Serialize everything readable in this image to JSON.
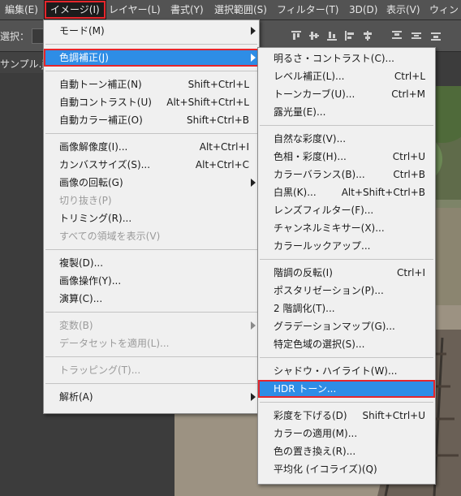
{
  "menubar": [
    {
      "label": "編集(E)",
      "active": false
    },
    {
      "label": "イメージ(I)",
      "active": true
    },
    {
      "label": "レイヤー(L)",
      "active": false
    },
    {
      "label": "書式(Y)",
      "active": false
    },
    {
      "label": "選択範囲(S)",
      "active": false
    },
    {
      "label": "フィルター(T)",
      "active": false
    },
    {
      "label": "3D(D)",
      "active": false
    },
    {
      "label": "表示(V)",
      "active": false
    },
    {
      "label": "ウィン",
      "active": false
    }
  ],
  "options_bar": {
    "label": "選択：",
    "box_text": "L"
  },
  "doc_tab": {
    "label": "サンプル.j"
  },
  "image_menu": [
    {
      "label": "モード(M)",
      "shortcut": "",
      "submenu": true,
      "disabled": false
    },
    {
      "separator": true
    },
    {
      "label": "色調補正(J)",
      "shortcut": "",
      "submenu": true,
      "disabled": false,
      "highlighted": true,
      "boxed": true
    },
    {
      "separator": true
    },
    {
      "label": "自動トーン補正(N)",
      "shortcut": "Shift+Ctrl+L",
      "disabled": false
    },
    {
      "label": "自動コントラスト(U)",
      "shortcut": "Alt+Shift+Ctrl+L",
      "disabled": false
    },
    {
      "label": "自動カラー補正(O)",
      "shortcut": "Shift+Ctrl+B",
      "disabled": false
    },
    {
      "separator": true
    },
    {
      "label": "画像解像度(I)...",
      "shortcut": "Alt+Ctrl+I",
      "disabled": false
    },
    {
      "label": "カンバスサイズ(S)...",
      "shortcut": "Alt+Ctrl+C",
      "disabled": false
    },
    {
      "label": "画像の回転(G)",
      "shortcut": "",
      "submenu": true,
      "disabled": false
    },
    {
      "label": "切り抜き(P)",
      "shortcut": "",
      "disabled": true
    },
    {
      "label": "トリミング(R)...",
      "shortcut": "",
      "disabled": false
    },
    {
      "label": "すべての領域を表示(V)",
      "shortcut": "",
      "disabled": true
    },
    {
      "separator": true
    },
    {
      "label": "複製(D)...",
      "shortcut": "",
      "disabled": false
    },
    {
      "label": "画像操作(Y)...",
      "shortcut": "",
      "disabled": false
    },
    {
      "label": "演算(C)...",
      "shortcut": "",
      "disabled": false
    },
    {
      "separator": true
    },
    {
      "label": "変数(B)",
      "shortcut": "",
      "submenu": true,
      "disabled": true
    },
    {
      "label": "データセットを適用(L)...",
      "shortcut": "",
      "disabled": true
    },
    {
      "separator": true
    },
    {
      "label": "トラッピング(T)...",
      "shortcut": "",
      "disabled": true
    },
    {
      "separator": true
    },
    {
      "label": "解析(A)",
      "shortcut": "",
      "submenu": true,
      "disabled": false
    }
  ],
  "adjust_menu": [
    {
      "label": "明るさ・コントラスト(C)...",
      "shortcut": "",
      "disabled": false
    },
    {
      "label": "レベル補正(L)...",
      "shortcut": "Ctrl+L",
      "disabled": false
    },
    {
      "label": "トーンカーブ(U)...",
      "shortcut": "Ctrl+M",
      "disabled": false
    },
    {
      "label": "露光量(E)...",
      "shortcut": "",
      "disabled": false
    },
    {
      "separator": true
    },
    {
      "label": "自然な彩度(V)...",
      "shortcut": "",
      "disabled": false
    },
    {
      "label": "色相・彩度(H)...",
      "shortcut": "Ctrl+U",
      "disabled": false
    },
    {
      "label": "カラーバランス(B)...",
      "shortcut": "Ctrl+B",
      "disabled": false
    },
    {
      "label": "白黒(K)...",
      "shortcut": "Alt+Shift+Ctrl+B",
      "disabled": false
    },
    {
      "label": "レンズフィルター(F)...",
      "shortcut": "",
      "disabled": false
    },
    {
      "label": "チャンネルミキサー(X)...",
      "shortcut": "",
      "disabled": false
    },
    {
      "label": "カラールックアップ...",
      "shortcut": "",
      "disabled": false
    },
    {
      "separator": true
    },
    {
      "label": "階調の反転(I)",
      "shortcut": "Ctrl+I",
      "disabled": false
    },
    {
      "label": "ポスタリゼーション(P)...",
      "shortcut": "",
      "disabled": false
    },
    {
      "label": "2 階調化(T)...",
      "shortcut": "",
      "disabled": false
    },
    {
      "label": "グラデーションマップ(G)...",
      "shortcut": "",
      "disabled": false
    },
    {
      "label": "特定色域の選択(S)...",
      "shortcut": "",
      "disabled": false
    },
    {
      "separator": true
    },
    {
      "label": "シャドウ・ハイライト(W)...",
      "shortcut": "",
      "disabled": false
    },
    {
      "label": "HDR トーン...",
      "shortcut": "",
      "disabled": false,
      "highlighted": true,
      "boxed": true
    },
    {
      "separator": true
    },
    {
      "label": "彩度を下げる(D)",
      "shortcut": "Shift+Ctrl+U",
      "disabled": false
    },
    {
      "label": "カラーの適用(M)...",
      "shortcut": "",
      "disabled": false
    },
    {
      "label": "色の置き換え(R)...",
      "shortcut": "",
      "disabled": false
    },
    {
      "label": "平均化 (イコライズ)(Q)",
      "shortcut": "",
      "disabled": false
    }
  ],
  "colors": {
    "highlight": "#2e8de6",
    "annotation": "#e5262c"
  }
}
